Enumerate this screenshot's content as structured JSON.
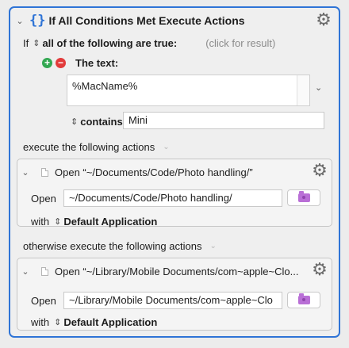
{
  "action": {
    "title": "If All Conditions Met Execute Actions",
    "if_label": "If",
    "condition_mode": "all of the following are true:",
    "click_hint": "(click for result)"
  },
  "condition": {
    "label": "The text:",
    "text_value": "%MacName%",
    "operator": "contains",
    "match_value": "Mini"
  },
  "execute_label": "execute the following actions",
  "otherwise_label": "otherwise execute the following actions",
  "open_action_1": {
    "title": "Open “~/Documents/Code/Photo handling/”",
    "open_label": "Open",
    "path": "~/Documents/Code/Photo handling/",
    "with_label": "with",
    "application": "Default Application"
  },
  "open_action_2": {
    "title": "Open “~/Library/Mobile Documents/com~apple~Clo...",
    "open_label": "Open",
    "path": "~/Library/Mobile Documents/com~apple~Clo",
    "with_label": "with",
    "application": "Default Application"
  },
  "colors": {
    "accent": "#2f74d6",
    "add": "#33a852",
    "remove": "#e23b3b",
    "folder": "#b96fd6"
  }
}
